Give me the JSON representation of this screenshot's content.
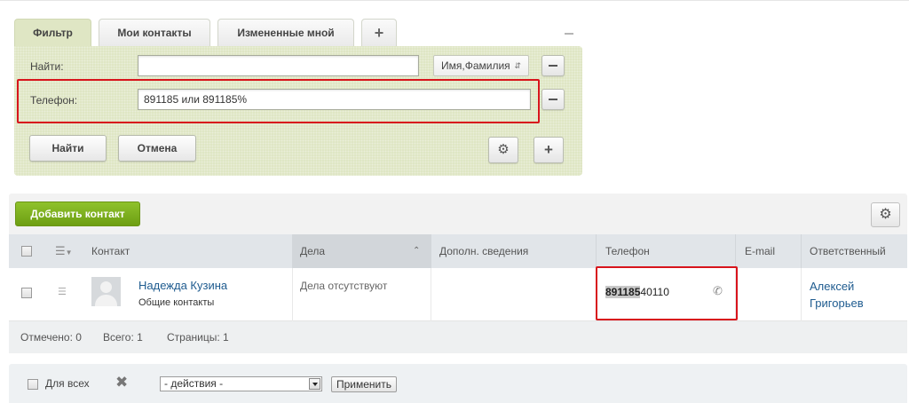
{
  "filter": {
    "tabs": [
      {
        "label": "Фильтр",
        "active": true
      },
      {
        "label": "Мои контакты",
        "active": false
      },
      {
        "label": "Измененные мной",
        "active": false
      },
      {
        "label": "+",
        "active": false
      }
    ],
    "find_label": "Найти:",
    "find_value": "",
    "find_field_select": "Имя,Фамилия",
    "phone_label": "Телефон:",
    "phone_value": "891185 или 891185%",
    "find_button": "Найти",
    "cancel_button": "Отмена"
  },
  "grid": {
    "add_button": "Добавить контакт",
    "columns": [
      "Контакт",
      "Дела",
      "Дополн. сведения",
      "Телефон",
      "E-mail",
      "Ответственный"
    ],
    "sorted_column": "Дела",
    "rows": [
      {
        "name": "Надежда Кузина",
        "type": "Общие контакты",
        "deals": "Дела отсутствуют",
        "extra": "",
        "phone_match": "891185",
        "phone_rest": "40110",
        "email": "",
        "responsible_first": "Алексей",
        "responsible_last": "Григорьев"
      }
    ],
    "footer": {
      "checked": "Отмечено: 0",
      "total": "Всего: 1",
      "pages": "Страницы: 1"
    }
  },
  "actions": {
    "for_all_label": "Для всех",
    "action_select": "- действия -",
    "apply_button": "Применить"
  },
  "colors": {
    "filter_bg": "#dfe6c4",
    "highlight_border": "#d8141c",
    "add_button": "#7bb01d",
    "link": "#1e5b8f"
  }
}
